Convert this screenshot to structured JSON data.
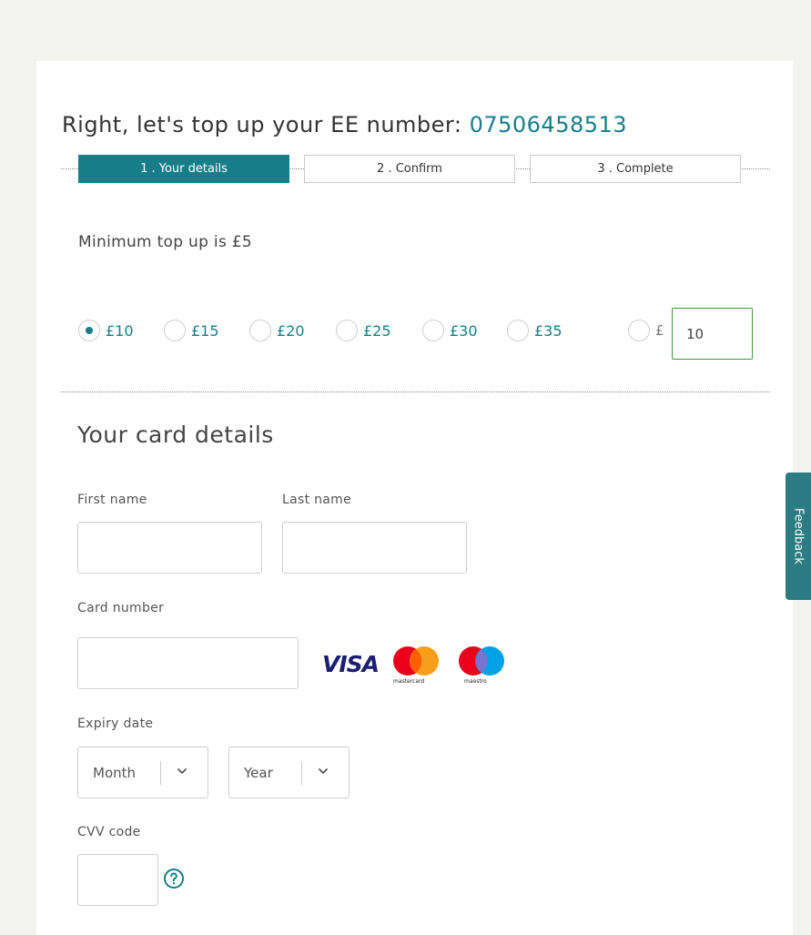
{
  "heading": {
    "prefix": "Right, let's top up your EE number: ",
    "number": "07506458513"
  },
  "steps": [
    {
      "label": "1 . Your details",
      "active": true
    },
    {
      "label": "2 . Confirm",
      "active": false
    },
    {
      "label": "3 . Complete",
      "active": false
    }
  ],
  "minimum_text": "Minimum top up is £5",
  "amounts": {
    "options": [
      {
        "label": "£10",
        "checked": true
      },
      {
        "label": "£15",
        "checked": false
      },
      {
        "label": "£20",
        "checked": false
      },
      {
        "label": "£25",
        "checked": false
      },
      {
        "label": "£30",
        "checked": false
      },
      {
        "label": "£35",
        "checked": false
      }
    ],
    "custom_symbol": "£",
    "custom_value": "10"
  },
  "card_section": {
    "title": "Your card details",
    "first_name_label": "First name",
    "last_name_label": "Last name",
    "card_number_label": "Card number",
    "expiry_label": "Expiry date",
    "month_placeholder": "Month",
    "year_placeholder": "Year",
    "cvv_label": "CVV code"
  },
  "card_logos": {
    "visa": "VISA",
    "mastercard": "mastercard",
    "maestro": "maestro"
  },
  "feedback_label": "Feedback",
  "colors": {
    "teal": "#177e89",
    "feedback": "#2c7c84",
    "input_focus": "#3c9c3c"
  }
}
